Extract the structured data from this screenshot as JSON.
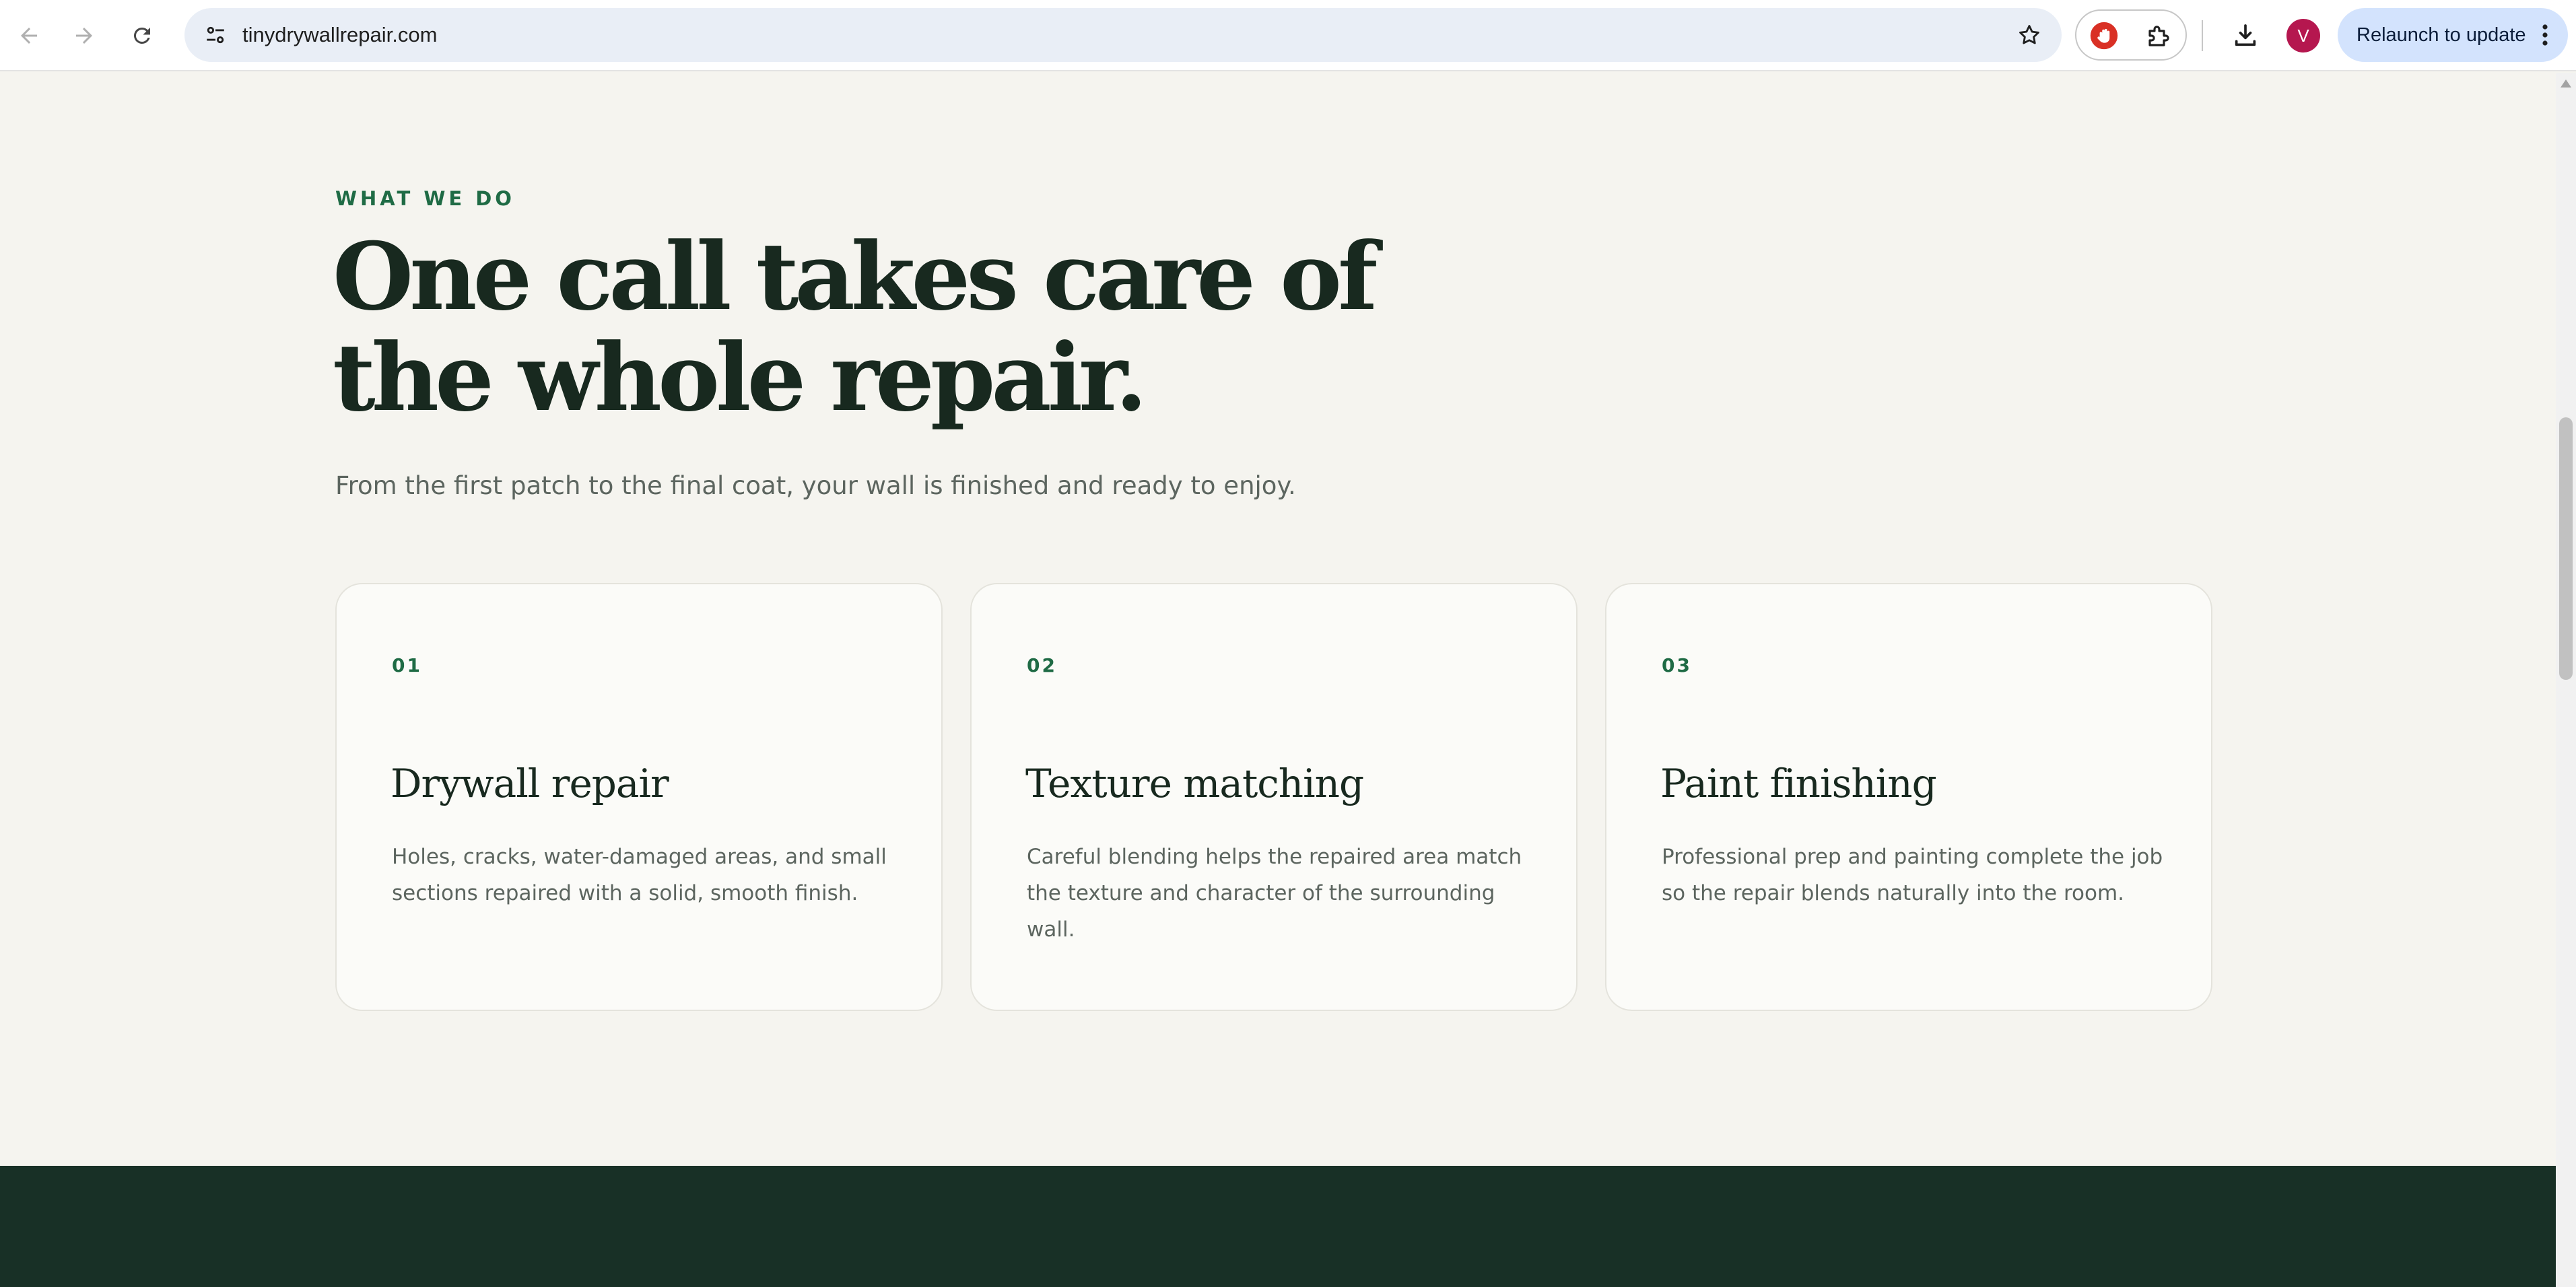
{
  "browser": {
    "url": "tinydrywallrepair.com",
    "profile_initial": "V",
    "relaunch_label": "Relaunch to update",
    "icons": {
      "back": "arrow-left-icon",
      "forward": "arrow-right-icon",
      "reload": "reload-icon",
      "site_info": "tune-icon",
      "bookmark": "star-icon",
      "extension_1": "stop-hand-icon",
      "extension_2": "puzzle-icon",
      "downloads": "download-icon",
      "menu": "kebab-menu-icon"
    },
    "colors": {
      "omnibox": "#e9eef6",
      "relaunch": "#d3e3fd",
      "avatar": "#b5174f",
      "extension_red": "#d93025"
    }
  },
  "section": {
    "eyebrow": "WHAT WE DO",
    "headline_line1": "One call takes care of",
    "headline_line2": "the whole repair.",
    "subtitle": "From the first patch to the final coat, your wall is finished and ready to enjoy."
  },
  "services": [
    {
      "number": "01",
      "title": "Drywall repair",
      "description": "Holes, cracks, water-damaged areas, and small sections repaired with a solid, smooth finish."
    },
    {
      "number": "02",
      "title": "Texture matching",
      "description": "Careful blending helps the repaired area match the texture and character of the surrounding wall."
    },
    {
      "number": "03",
      "title": "Paint finishing",
      "description": "Professional prep and painting complete the job so the repair blends naturally into the room."
    }
  ],
  "colors": {
    "background": "#f5f4ef",
    "accent_green": "#1f6b45",
    "heading": "#18291f",
    "body_text": "#5c655f",
    "card_bg": "#fbfbf8",
    "dark_band": "#183026"
  }
}
